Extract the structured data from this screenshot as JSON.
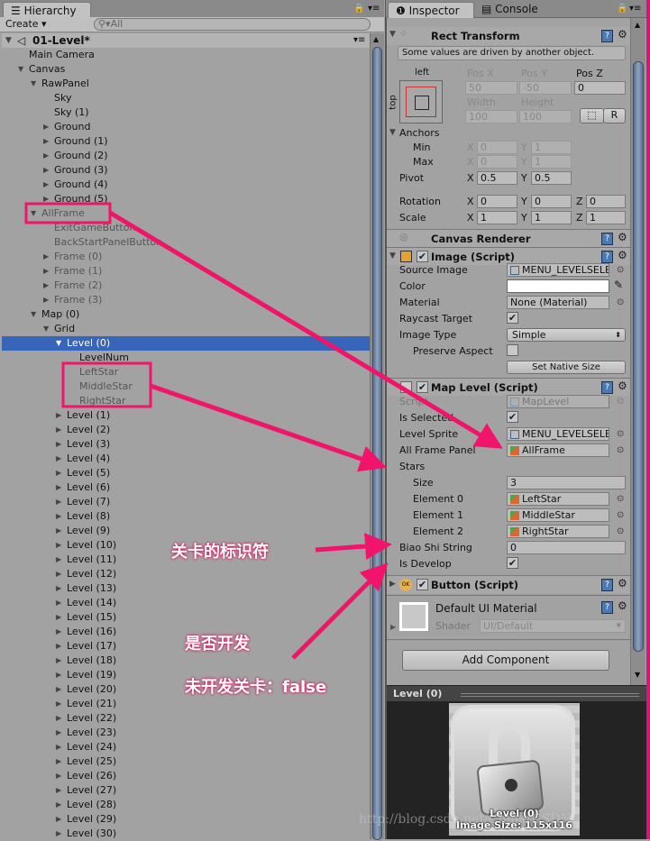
{
  "hierarchy": {
    "tab": "Hierarchy",
    "create": "Create",
    "search_placeholder": "All",
    "scene": "01-Level*",
    "rows": [
      {
        "label": "Main Camera",
        "depth": 1,
        "arrow": ""
      },
      {
        "label": "Canvas",
        "depth": 1,
        "arrow": "down"
      },
      {
        "label": "RawPanel",
        "depth": 2,
        "arrow": "down"
      },
      {
        "label": "Sky",
        "depth": 3,
        "arrow": ""
      },
      {
        "label": "Sky (1)",
        "depth": 3,
        "arrow": ""
      },
      {
        "label": "Ground",
        "depth": 3,
        "arrow": "right"
      },
      {
        "label": "Ground (1)",
        "depth": 3,
        "arrow": "right"
      },
      {
        "label": "Ground (2)",
        "depth": 3,
        "arrow": "right"
      },
      {
        "label": "Ground (3)",
        "depth": 3,
        "arrow": "right"
      },
      {
        "label": "Ground (4)",
        "depth": 3,
        "arrow": "right"
      },
      {
        "label": "Ground (5)",
        "depth": 3,
        "arrow": "right"
      },
      {
        "label": "AllFrame",
        "depth": 2,
        "arrow": "down",
        "inactive": true
      },
      {
        "label": "ExitGameButton",
        "depth": 3,
        "arrow": "",
        "inactive": true
      },
      {
        "label": "BackStartPanelButton",
        "depth": 3,
        "arrow": "",
        "inactive": true
      },
      {
        "label": "Frame (0)",
        "depth": 3,
        "arrow": "right",
        "inactive": true
      },
      {
        "label": "Frame (1)",
        "depth": 3,
        "arrow": "right",
        "inactive": true
      },
      {
        "label": "Frame (2)",
        "depth": 3,
        "arrow": "right",
        "inactive": true
      },
      {
        "label": "Frame (3)",
        "depth": 3,
        "arrow": "right",
        "inactive": true
      },
      {
        "label": "Map (0)",
        "depth": 2,
        "arrow": "down"
      },
      {
        "label": "Grid",
        "depth": 3,
        "arrow": "down"
      },
      {
        "label": "Level (0)",
        "depth": 4,
        "arrow": "down",
        "selected": true
      },
      {
        "label": "LevelNum",
        "depth": 5,
        "arrow": ""
      },
      {
        "label": "LeftStar",
        "depth": 5,
        "arrow": "",
        "inactive": true
      },
      {
        "label": "MiddleStar",
        "depth": 5,
        "arrow": "",
        "inactive": true
      },
      {
        "label": "RightStar",
        "depth": 5,
        "arrow": "",
        "inactive": true
      },
      {
        "label": "Level (1)",
        "depth": 4,
        "arrow": "right"
      },
      {
        "label": "Level (2)",
        "depth": 4,
        "arrow": "right"
      },
      {
        "label": "Level (3)",
        "depth": 4,
        "arrow": "right"
      },
      {
        "label": "Level (4)",
        "depth": 4,
        "arrow": "right"
      },
      {
        "label": "Level (5)",
        "depth": 4,
        "arrow": "right"
      },
      {
        "label": "Level (6)",
        "depth": 4,
        "arrow": "right"
      },
      {
        "label": "Level (7)",
        "depth": 4,
        "arrow": "right"
      },
      {
        "label": "Level (8)",
        "depth": 4,
        "arrow": "right"
      },
      {
        "label": "Level (9)",
        "depth": 4,
        "arrow": "right"
      },
      {
        "label": "Level (10)",
        "depth": 4,
        "arrow": "right"
      },
      {
        "label": "Level (11)",
        "depth": 4,
        "arrow": "right"
      },
      {
        "label": "Level (12)",
        "depth": 4,
        "arrow": "right"
      },
      {
        "label": "Level (13)",
        "depth": 4,
        "arrow": "right"
      },
      {
        "label": "Level (14)",
        "depth": 4,
        "arrow": "right"
      },
      {
        "label": "Level (15)",
        "depth": 4,
        "arrow": "right"
      },
      {
        "label": "Level (16)",
        "depth": 4,
        "arrow": "right"
      },
      {
        "label": "Level (17)",
        "depth": 4,
        "arrow": "right"
      },
      {
        "label": "Level (18)",
        "depth": 4,
        "arrow": "right"
      },
      {
        "label": "Level (19)",
        "depth": 4,
        "arrow": "right"
      },
      {
        "label": "Level (20)",
        "depth": 4,
        "arrow": "right"
      },
      {
        "label": "Level (21)",
        "depth": 4,
        "arrow": "right"
      },
      {
        "label": "Level (22)",
        "depth": 4,
        "arrow": "right"
      },
      {
        "label": "Level (23)",
        "depth": 4,
        "arrow": "right"
      },
      {
        "label": "Level (24)",
        "depth": 4,
        "arrow": "right"
      },
      {
        "label": "Level (25)",
        "depth": 4,
        "arrow": "right"
      },
      {
        "label": "Level (26)",
        "depth": 4,
        "arrow": "right"
      },
      {
        "label": "Level (27)",
        "depth": 4,
        "arrow": "right"
      },
      {
        "label": "Level (28)",
        "depth": 4,
        "arrow": "right"
      },
      {
        "label": "Level (29)",
        "depth": 4,
        "arrow": "right"
      },
      {
        "label": "Level (30)",
        "depth": 4,
        "arrow": "right"
      }
    ]
  },
  "inspector": {
    "tab": "Inspector",
    "console_tab": "Console",
    "rect": {
      "title": "Rect Transform",
      "note": "Some values are driven by another object.",
      "anchor_h": "left",
      "anchor_v": "top",
      "pos_x_label": "Pos X",
      "pos_y_label": "Pos Y",
      "pos_z_label": "Pos Z",
      "pos_x": "50",
      "pos_y": "-50",
      "pos_z": "0",
      "width_label": "Width",
      "height_label": "Height",
      "width": "100",
      "height": "100",
      "r_button": "R",
      "anchors": "Anchors",
      "min": "Min",
      "max": "Max",
      "min_x": "0",
      "min_y": "1",
      "max_x": "0",
      "max_y": "1",
      "pivot": "Pivot",
      "pivot_x": "0.5",
      "pivot_y": "0.5",
      "rotation": "Rotation",
      "rot_x": "0",
      "rot_y": "0",
      "rot_z": "0",
      "scale": "Scale",
      "scale_x": "1",
      "scale_y": "1",
      "scale_z": "1",
      "x": "X",
      "y": "Y",
      "z": "Z"
    },
    "canvas_renderer": "Canvas Renderer",
    "image": {
      "title": "Image (Script)",
      "source_image": "Source Image",
      "source_value": "MENU_LEVELSELE",
      "color": "Color",
      "material": "Material",
      "material_value": "None (Material)",
      "raycast": "Raycast Target",
      "raycast_checked": true,
      "image_type": "Image Type",
      "image_type_value": "Simple",
      "preserve": "Preserve Aspect",
      "preserve_checked": false,
      "native": "Set Native Size"
    },
    "map_level": {
      "title": "Map Level (Script)",
      "script": "Script",
      "script_value": "MapLevel",
      "is_selected": "Is Selected",
      "is_selected_checked": true,
      "level_sprite": "Level Sprite",
      "level_sprite_value": "MENU_LEVELSELE",
      "all_frame": "All Frame Panel",
      "all_frame_value": "AllFrame",
      "stars": "Stars",
      "size": "Size",
      "size_value": "3",
      "elements": [
        {
          "label": "Element 0",
          "value": "LeftStar"
        },
        {
          "label": "Element 1",
          "value": "MiddleStar"
        },
        {
          "label": "Element 2",
          "value": "RightStar"
        }
      ],
      "biao": "Biao Shi String",
      "biao_value": "0",
      "is_develop": "Is Develop",
      "is_develop_checked": true
    },
    "button": {
      "title": "Button (Script)"
    },
    "material": {
      "title": "Default UI Material",
      "shader": "Shader",
      "shader_value": "UI/Default"
    },
    "add_component": "Add Component",
    "preview": {
      "title": "Level (0)",
      "caption": "Level (0)",
      "size": "Image Size: 115x116"
    }
  },
  "annotations": {
    "identifier": "关卡的标识符",
    "develop": "是否开发",
    "undeveloped": "未开发关卡：false",
    "color": "#f0146a"
  },
  "watermark": "http://blog.csdn.net/ChinarCSDN"
}
